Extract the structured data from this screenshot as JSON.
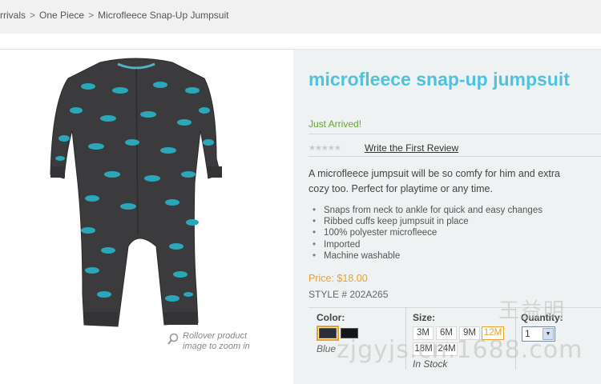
{
  "breadcrumb": {
    "items": [
      "rrivals",
      "One Piece"
    ],
    "separator": ">",
    "current": "Microfleece Snap-Up Jumpsuit"
  },
  "image": {
    "zoom_hint": "Rollover product image to zoom in",
    "icon": "magnifier-icon"
  },
  "product": {
    "title": "microfleece snap-up jumpsuit",
    "badge": "Just Arrived!",
    "rating_stars": "★★★★★",
    "review_link": "Write the First Review",
    "description": "A microfleece jumpsuit will be so comfy for him and extra cozy too. Perfect for playtime or any time.",
    "features": [
      "Snaps from neck to ankle for quick and easy changes",
      "Ribbed cuffs keep jumpsuit in place",
      "100% polyester microfleece",
      "Imported",
      "Machine washable"
    ],
    "price": "Price: $18.00",
    "style": "STYLE # 202A265"
  },
  "options": {
    "color_label": "Color:",
    "colors": [
      {
        "name": "Blue",
        "hex": "#2b2f3a",
        "selected": true
      },
      {
        "name": "Black",
        "hex": "#15161c",
        "selected": false
      }
    ],
    "selected_color_name": "Blue",
    "size_label": "Size:",
    "sizes": [
      "3M",
      "6M",
      "9M",
      "12M",
      "18M",
      "24M"
    ],
    "selected_size": "12M",
    "stock": "In Stock",
    "quantity_label": "Quantity:",
    "quantity_value": "1"
  },
  "watermark": {
    "line1": "王益明",
    "line2": "zjgyjs.cn.1688.com"
  },
  "colors": {
    "title": "#4fc3dc",
    "accent": "#f0a020",
    "green": "#67a52f",
    "detail_bg": "#eef2f2"
  }
}
